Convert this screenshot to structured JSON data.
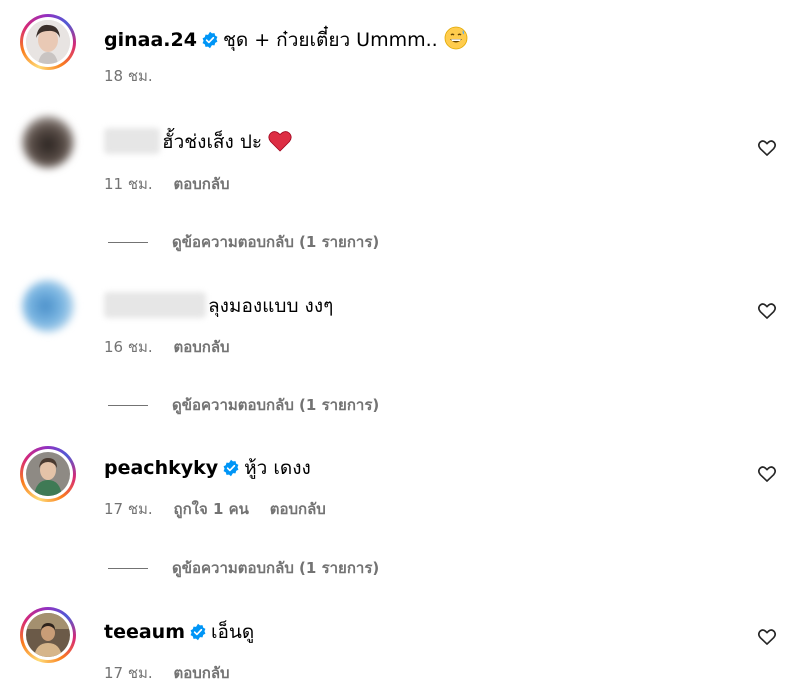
{
  "post": {
    "username": "ginaa.24",
    "caption": "ชุด + ก๋วยเตี๋ยว Ummm..",
    "time": "18 ชม."
  },
  "comments": [
    {
      "text": "ฮั้วช่งเส็ง ปะ",
      "time": "11 ชม.",
      "reply_label": "ตอบกลับ",
      "view_replies": "ดูข้อความตอบกลับ (1 รายการ)"
    },
    {
      "text": "ลุงมองแบบ งงๆ",
      "time": "16 ชม.",
      "reply_label": "ตอบกลับ",
      "view_replies": "ดูข้อความตอบกลับ (1 รายการ)"
    },
    {
      "username": "peachkyky",
      "text": "หู้ว เดงง",
      "time": "17 ชม.",
      "likes": "ถูกใจ 1 คน",
      "reply_label": "ตอบกลับ",
      "view_replies": "ดูข้อความตอบกลับ (1 รายการ)"
    },
    {
      "username": "teeaum",
      "text": "เอ็นดู",
      "time": "17 ชม.",
      "reply_label": "ตอบกลับ"
    }
  ],
  "colors": {
    "verified": "#0095f6",
    "heart_emoji": "#e0245e",
    "meta_text": "#737373"
  },
  "icons": [
    "verified-badge-icon",
    "heart-outline-icon",
    "red-heart-emoji",
    "grinning-sweat-emoji"
  ]
}
